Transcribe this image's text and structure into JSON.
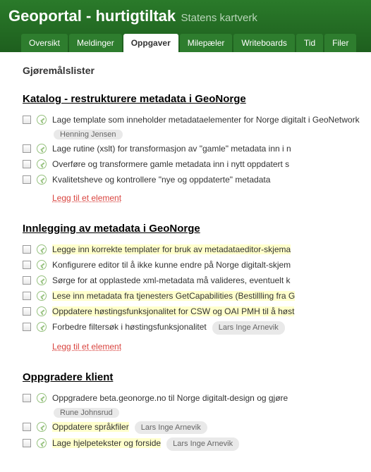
{
  "header": {
    "title": "Geoportal - hurtigtiltak",
    "subtitle": "Statens kartverk"
  },
  "tabs": [
    {
      "label": "Oversikt",
      "active": false
    },
    {
      "label": "Meldinger",
      "active": false
    },
    {
      "label": "Oppgaver",
      "active": true
    },
    {
      "label": "Milepæler",
      "active": false
    },
    {
      "label": "Writeboards",
      "active": false
    },
    {
      "label": "Tid",
      "active": false
    },
    {
      "label": "Filer",
      "active": false
    }
  ],
  "section_title": "Gjøremålslister",
  "add_label": "Legg til et element",
  "lists": [
    {
      "heading": "Katalog - restrukturere metadata i GeoNorge",
      "tasks": [
        {
          "text": "Lage template som inneholder metadataelementer for Norge digitalt i GeoNetwork",
          "hl": false,
          "assignee": "Henning Jensen",
          "assignee_below": true
        },
        {
          "text": "Lage rutine (xslt) for transformasjon av \"gamle\" metadata inn i n",
          "hl": false
        },
        {
          "text": "Overføre og transformere gamle metadata inn i nytt oppdatert s",
          "hl": false
        },
        {
          "text": "Kvalitetsheve og kontrollere \"nye og oppdaterte\" metadata",
          "hl": false
        }
      ],
      "show_add": true
    },
    {
      "heading": "Innlegging av metadata i GeoNorge",
      "tasks": [
        {
          "text": "Legge inn korrekte templater for bruk av metadataeditor-skjema",
          "hl": true
        },
        {
          "text": "Konfigurere editor til å ikke kunne endre på Norge digitalt-skjem",
          "hl": false
        },
        {
          "text": "Sørge for at opplastede xml-metadata må valideres, eventuelt k",
          "hl": false
        },
        {
          "text": "Lese inn metadata fra tjenesters GetCapabilities (Bestillling fra G",
          "hl": true
        },
        {
          "text": "Oppdatere høstingsfunksjonalitet for CSW og OAI PMH til å høst",
          "hl": true
        },
        {
          "text": "Forbedre filtersøk i høstingsfunksjonalitet",
          "hl": false,
          "assignee": "Lars Inge Arnevik"
        }
      ],
      "show_add": true
    },
    {
      "heading": "Oppgradere klient",
      "tasks": [
        {
          "text": "Oppgradere beta.geonorge.no til Norge digitalt-design og gjøre ",
          "hl": false,
          "assignee": "Rune Johnsrud",
          "assignee_below": true
        },
        {
          "text": "Oppdatere språkfiler",
          "hl": true,
          "assignee": "Lars Inge Arnevik"
        },
        {
          "text": "Lage hjelpetekster og forside",
          "hl": true,
          "assignee": "Lars Inge Arnevik"
        }
      ],
      "show_add": false
    }
  ]
}
